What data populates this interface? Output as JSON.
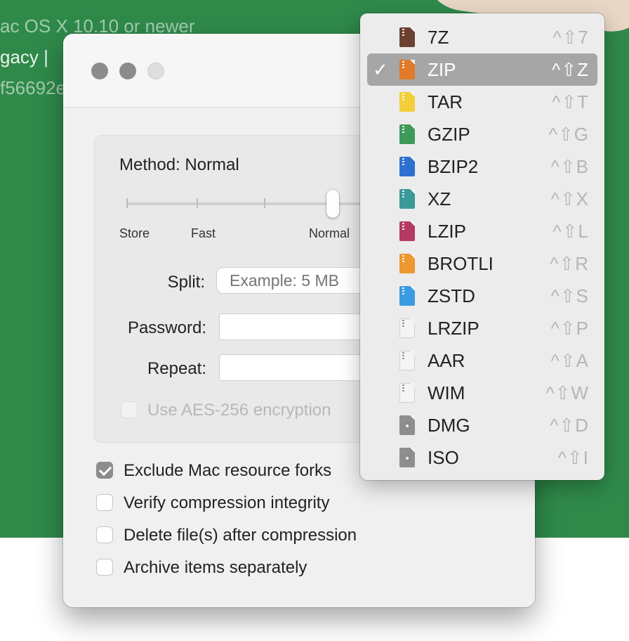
{
  "background": {
    "line1": "ac OS X 10.10 or newer",
    "line2": "gacy | ",
    "line3": "f56692e"
  },
  "dialog": {
    "method_label": "Method: Normal",
    "slider": {
      "ticks": [
        "Store",
        "Fast",
        "Normal"
      ],
      "level": 0.5
    },
    "split": {
      "label": "Split:",
      "placeholder": "Example: 5 MB"
    },
    "password": {
      "label": "Password:",
      "value": ""
    },
    "repeat": {
      "label": "Repeat:",
      "value": ""
    },
    "aes": {
      "label": "Use AES-256 encryption",
      "checked": false,
      "disabled": true
    },
    "options": [
      {
        "label": "Exclude Mac resource forks",
        "checked": true
      },
      {
        "label": "Verify compression integrity",
        "checked": false
      },
      {
        "label": "Delete file(s) after compression",
        "checked": false
      },
      {
        "label": "Archive items separately",
        "checked": false
      }
    ]
  },
  "format_menu": {
    "selected_check": "✓",
    "items": [
      {
        "label": "7Z",
        "shortcut": "^⇧7",
        "icon_color": "#6b4232",
        "icon": "zip-file-icon"
      },
      {
        "label": "ZIP",
        "shortcut": "^⇧Z",
        "icon_color": "#e07a2a",
        "icon": "zip-file-icon",
        "selected": true
      },
      {
        "label": "TAR",
        "shortcut": "^⇧T",
        "icon_color": "#f2cf3a",
        "icon": "zip-file-icon"
      },
      {
        "label": "GZIP",
        "shortcut": "^⇧G",
        "icon_color": "#3f9a5a",
        "icon": "zip-file-icon"
      },
      {
        "label": "BZIP2",
        "shortcut": "^⇧B",
        "icon_color": "#2f6fd0",
        "icon": "zip-file-icon"
      },
      {
        "label": "XZ",
        "shortcut": "^⇧X",
        "icon_color": "#3a9a98",
        "icon": "zip-file-icon"
      },
      {
        "label": "LZIP",
        "shortcut": "^⇧L",
        "icon_color": "#b43a62",
        "icon": "zip-file-icon"
      },
      {
        "label": "BROTLI",
        "shortcut": "^⇧R",
        "icon_color": "#ee9830",
        "icon": "zip-file-icon"
      },
      {
        "label": "ZSTD",
        "shortcut": "^⇧S",
        "icon_color": "#3b9be0",
        "icon": "zip-file-icon"
      },
      {
        "label": "LRZIP",
        "shortcut": "^⇧P",
        "icon_color": "#f4f4f4",
        "icon": "zip-file-icon"
      },
      {
        "label": "AAR",
        "shortcut": "^⇧A",
        "icon_color": "#f4f4f4",
        "icon": "zip-file-icon"
      },
      {
        "label": "WIM",
        "shortcut": "^⇧W",
        "icon_color": "#f4f4f4",
        "icon": "zip-file-icon"
      },
      {
        "label": "DMG",
        "shortcut": "^⇧D",
        "icon_color": "#8e8e8e",
        "icon": "disk-image-icon"
      },
      {
        "label": "ISO",
        "shortcut": "^⇧I",
        "icon_color": "#8e8e8e",
        "icon": "disk-image-icon"
      }
    ]
  }
}
